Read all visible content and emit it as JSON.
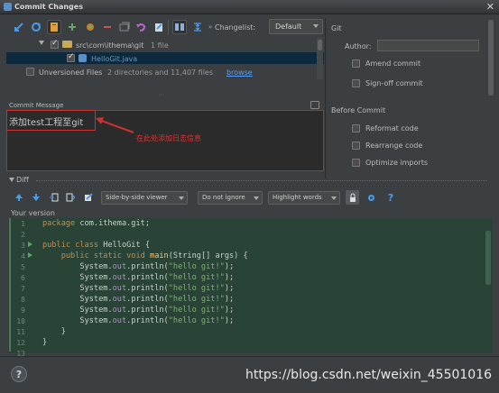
{
  "window": {
    "title": "Commit Changes",
    "close_glyph": "✕"
  },
  "toolbar": {
    "changelist_label": "Changelist:",
    "changelist_value": "Default"
  },
  "tree": {
    "folder": {
      "path": "src\\com\\ithema\\git",
      "count": "1 file"
    },
    "file": {
      "name": "HelloGit.java"
    },
    "unversioned": {
      "label": "Unversioned Files",
      "count": "2 directories and 11,407 files",
      "link": "browse"
    }
  },
  "git": {
    "section_title": "Git",
    "author_label": "Author:",
    "author_value": "",
    "amend_label": "Amend commit",
    "signoff_label": "Sign-off commit"
  },
  "before_commit": {
    "title": "Before Commit",
    "options": [
      "Reformat code",
      "Rearrange code",
      "Optimize imports"
    ]
  },
  "commit": {
    "label": "Commit Message",
    "message": "添加test工程至git",
    "annotation": "在此处添加日志信息"
  },
  "diff": {
    "header": "Diff",
    "viewer_mode": "Side-by-side viewer",
    "ignore_mode": "Do not ignore",
    "highlight_mode": "Highlight words",
    "version_label": "Your version"
  },
  "code": {
    "line_numbers": [
      "1",
      "2",
      "3",
      "4",
      "5",
      "6",
      "7",
      "8",
      "9",
      "10",
      "11",
      "12",
      "13"
    ]
  },
  "footer": {
    "help_glyph": "?",
    "watermark": "https://blog.csdn.net/weixin_45501016"
  },
  "colors": {
    "accent": "#4a9be8",
    "annotation": "#e03030",
    "diff_bg": "#294436",
    "selection": "#0d293e"
  }
}
